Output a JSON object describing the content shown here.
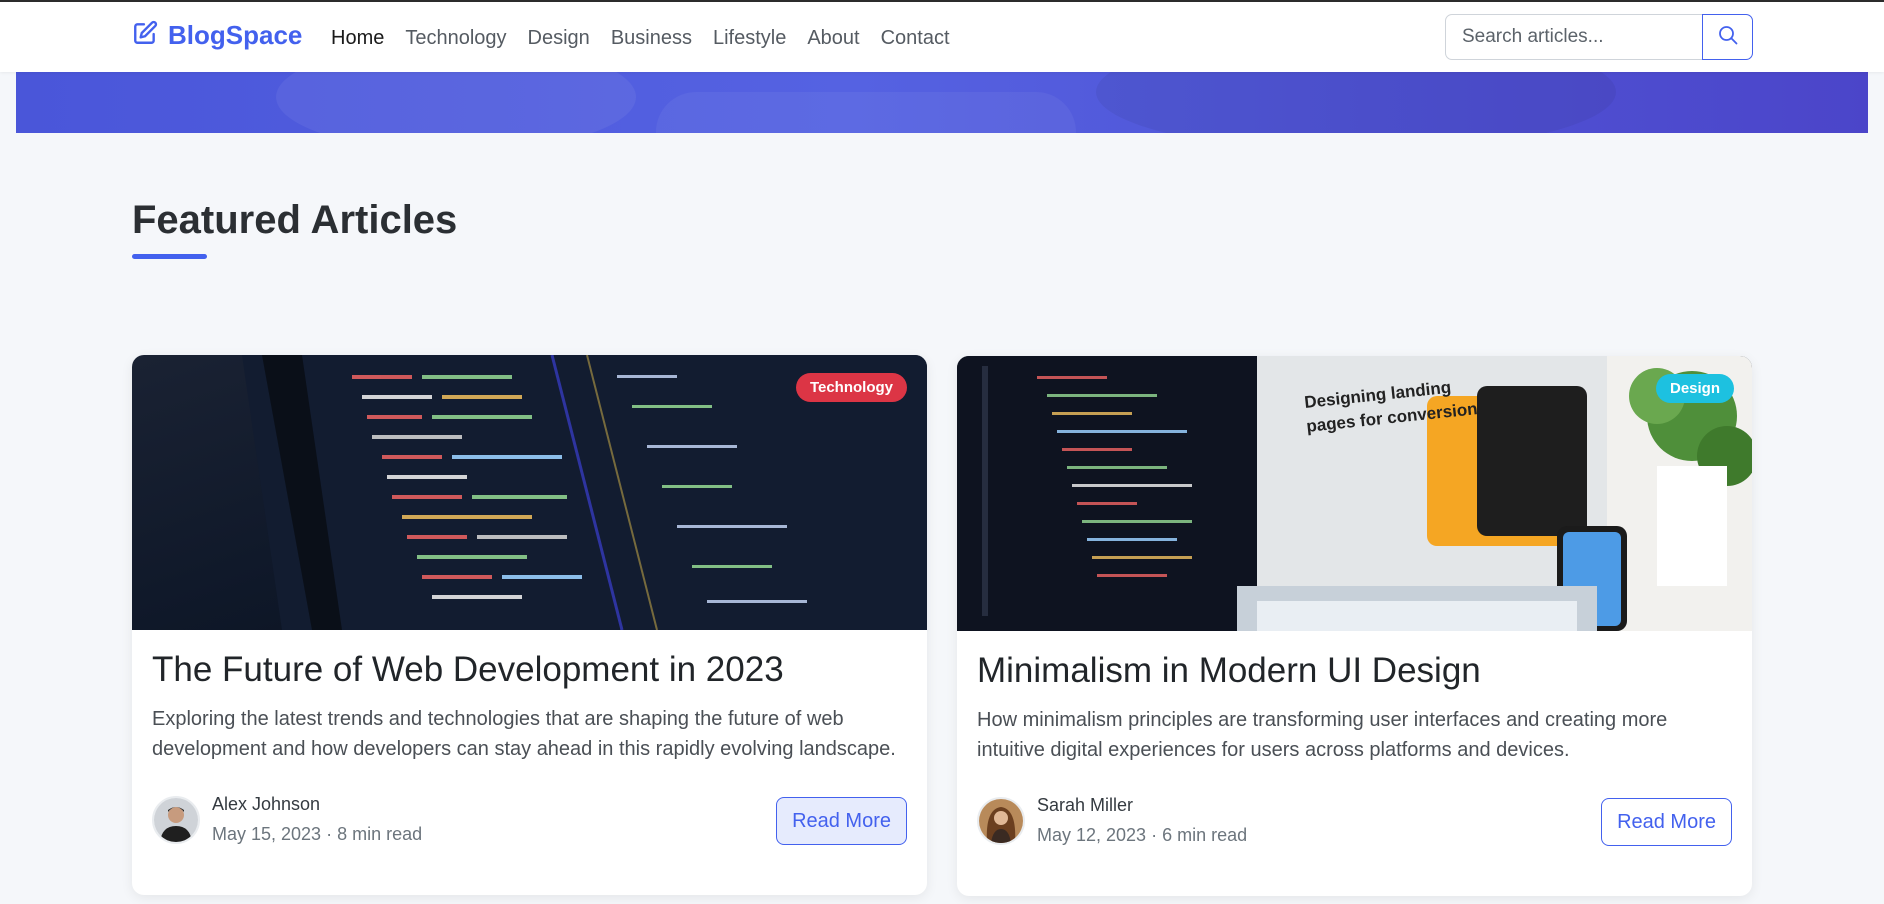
{
  "brand": {
    "name": "BlogSpace",
    "icon": "pencil-square-icon",
    "color": "#4361ee"
  },
  "nav": {
    "items": [
      {
        "label": "Home",
        "active": true
      },
      {
        "label": "Technology"
      },
      {
        "label": "Design"
      },
      {
        "label": "Business"
      },
      {
        "label": "Lifestyle"
      },
      {
        "label": "About"
      },
      {
        "label": "Contact"
      }
    ]
  },
  "search": {
    "placeholder": "Search articles...",
    "value": "",
    "icon": "search-icon"
  },
  "section": {
    "title": "Featured Articles"
  },
  "articles": [
    {
      "category": "Technology",
      "category_color": "#dc3545",
      "title": "The Future of Web Development in 2023",
      "excerpt": "Exploring the latest trends and technologies that are shaping the future of web development and how developers can stay ahead in this rapidly evolving landscape.",
      "author": "Alex Johnson",
      "meta": "May 15, 2023 · 8 min read",
      "button": "Read More"
    },
    {
      "category": "Design",
      "category_color": "#1dc1e0",
      "title": "Minimalism in Modern UI Design",
      "excerpt": "How minimalism principles are transforming user interfaces and creating more intuitive digital experiences for users across platforms and devices.",
      "author": "Sarah Miller",
      "meta": "May 12, 2023 · 6 min read",
      "button": "Read More",
      "image_text": "Designing landing pages for conversion"
    }
  ]
}
